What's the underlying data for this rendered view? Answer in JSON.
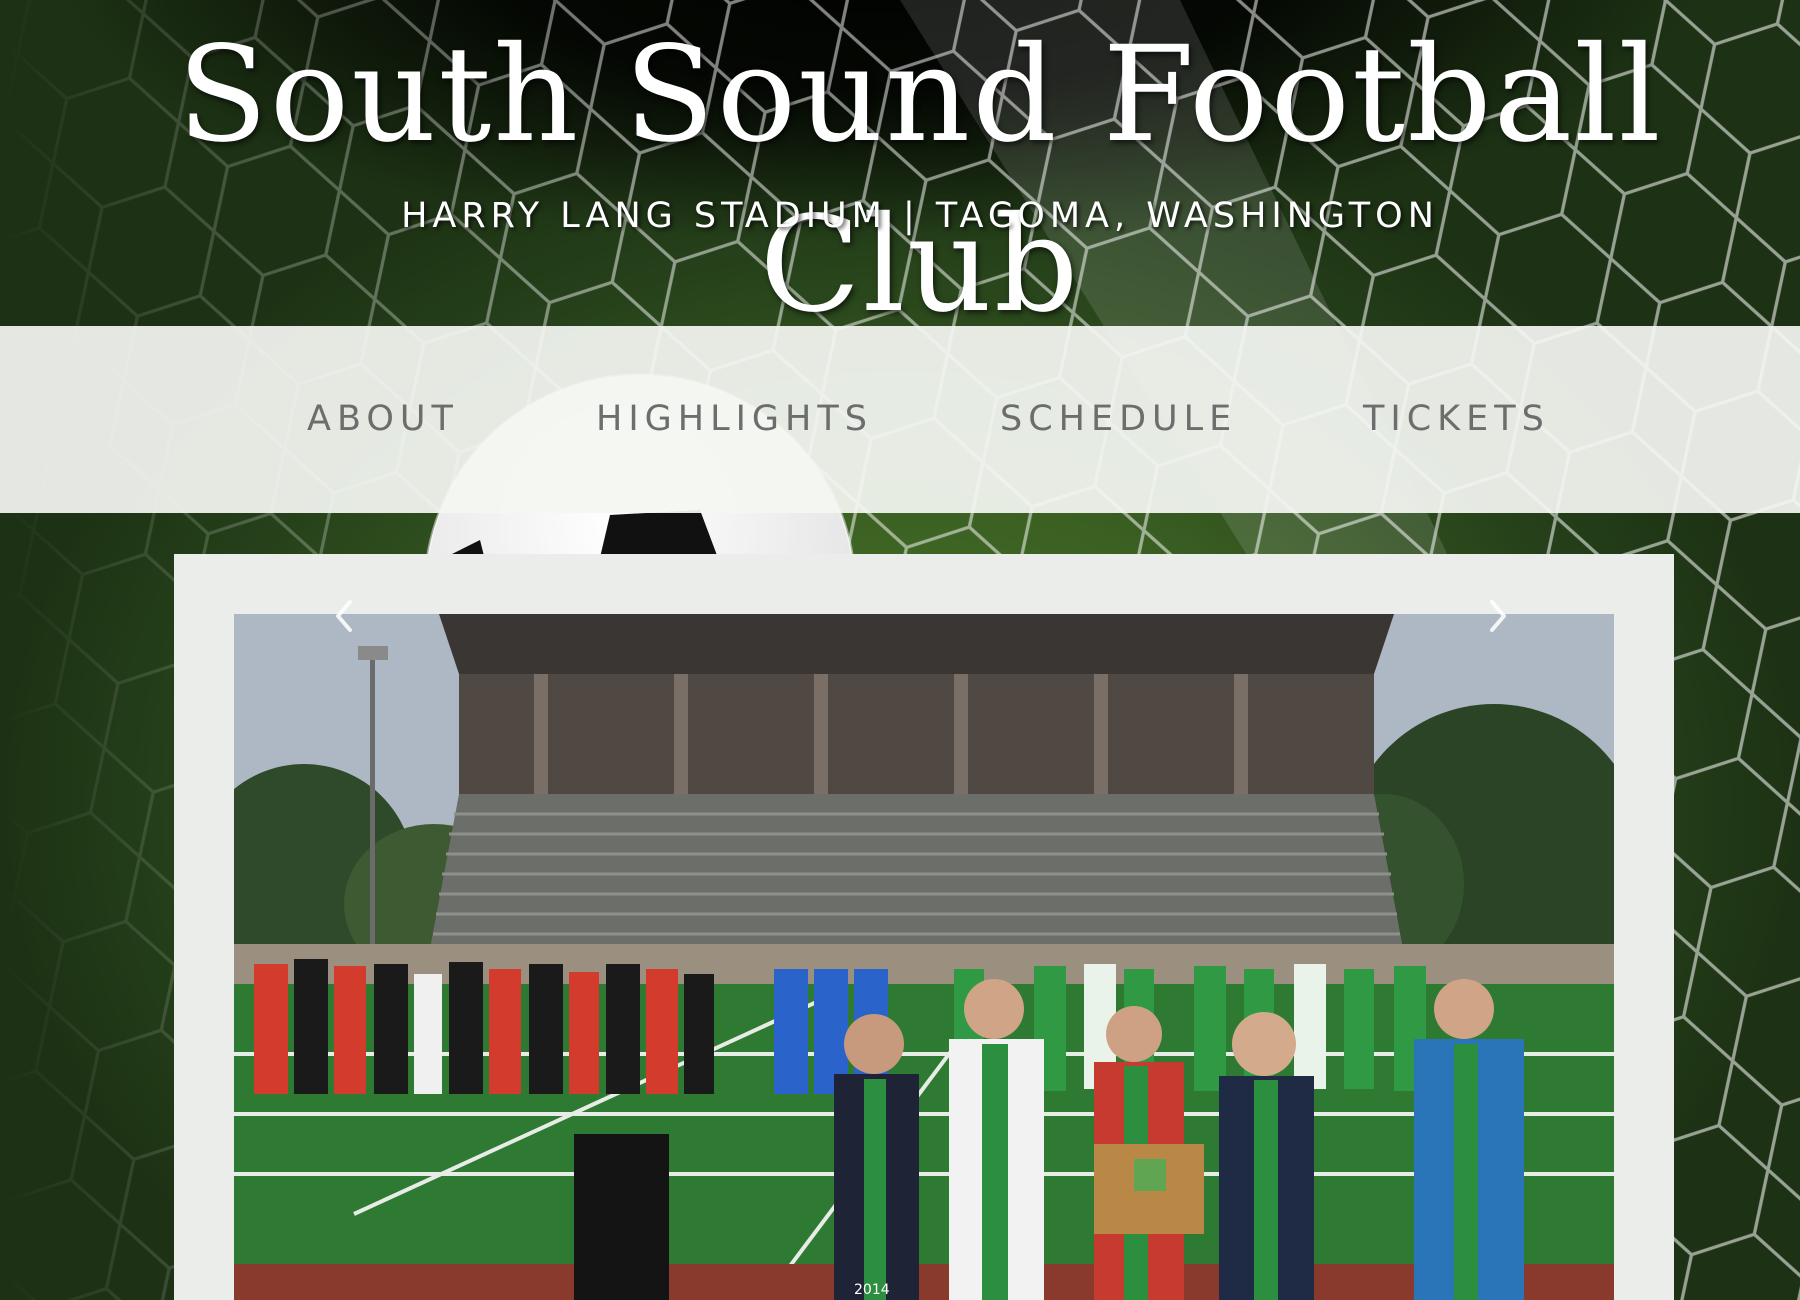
{
  "header": {
    "site_title": "South Sound Football Club",
    "tagline": "HARRY LANG STADIUM | TACOMA, WASHINGTON"
  },
  "nav": {
    "items": [
      {
        "label": "ABOUT"
      },
      {
        "label": "HIGHLIGHTS"
      },
      {
        "label": "SCHEDULE"
      },
      {
        "label": "TICKETS"
      }
    ]
  },
  "slideshow": {
    "prev_icon": "chevron-left-icon",
    "next_icon": "chevron-right-icon",
    "image": {
      "plaque_text": "2014"
    }
  },
  "colors": {
    "nav_background": "#f4f6f2",
    "nav_text": "#6d6d6d",
    "card_background": "#ebedea",
    "title_text": "#ffffff"
  }
}
